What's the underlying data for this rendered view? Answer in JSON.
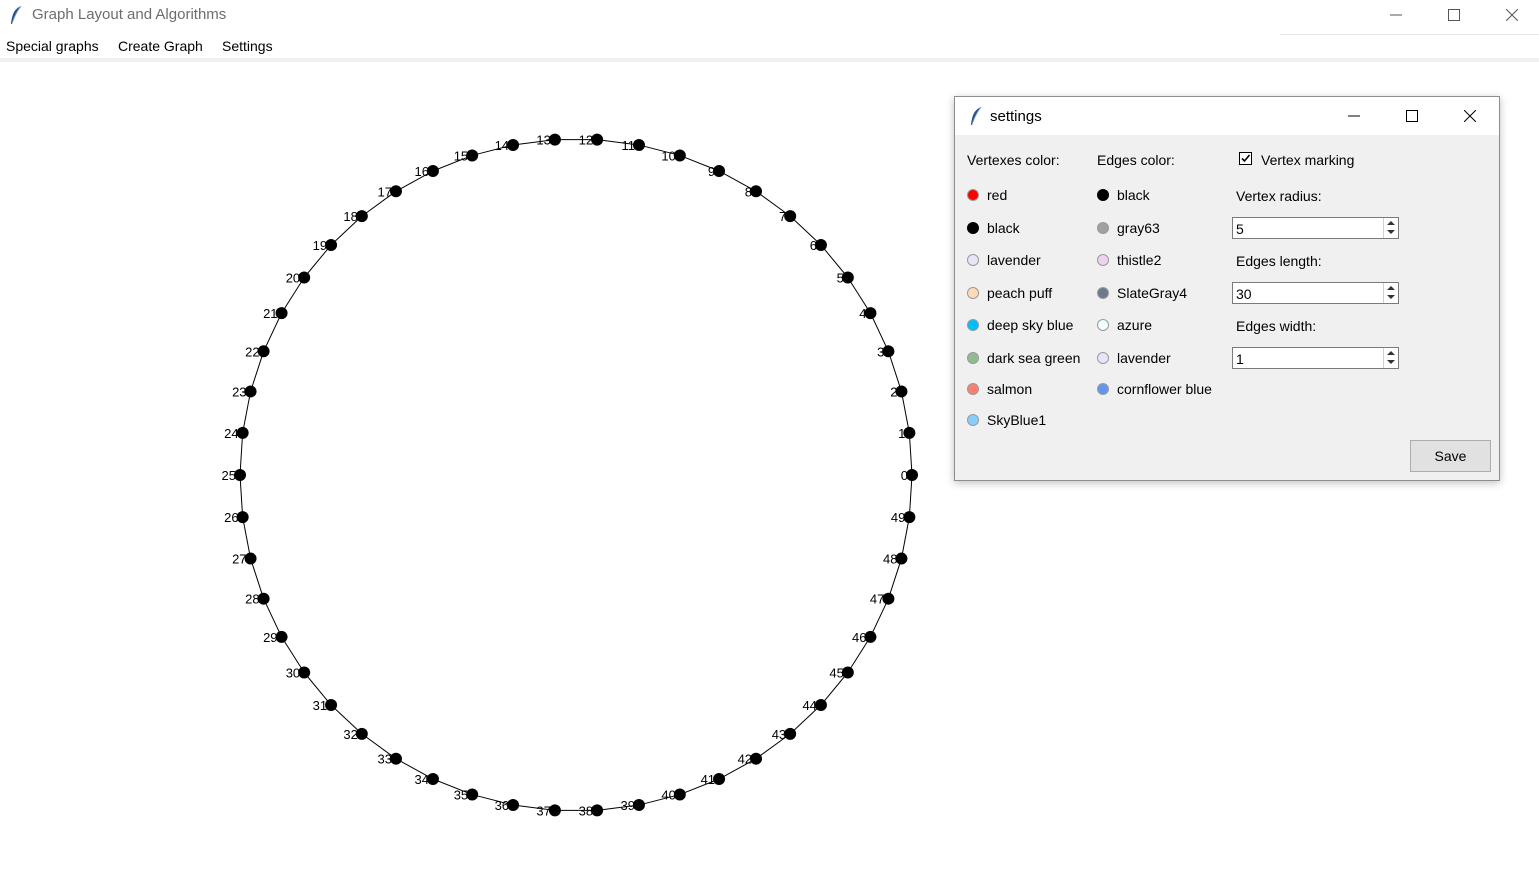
{
  "window": {
    "title": "Graph Layout and Algorithms"
  },
  "menu": [
    "Special graphs",
    "Create Graph",
    "Settings"
  ],
  "graph": {
    "vertex_count": 50,
    "vertex_labels": [
      "0",
      "1",
      "2",
      "3",
      "4",
      "5",
      "6",
      "7",
      "8",
      "9",
      "10",
      "11",
      "12",
      "13",
      "14",
      "15",
      "16",
      "17",
      "18",
      "19",
      "20",
      "21",
      "22",
      "23",
      "24",
      "25",
      "26",
      "27",
      "28",
      "29",
      "30",
      "31",
      "32",
      "33",
      "34",
      "35",
      "36",
      "37",
      "38",
      "39",
      "40",
      "41",
      "42",
      "43",
      "44",
      "45",
      "46",
      "47",
      "48",
      "49"
    ],
    "vertex_color": "#000000",
    "edge_color": "#000000"
  },
  "settings": {
    "title": "settings",
    "vertex_color_label": "Vertexes color:",
    "edge_color_label": "Edges color:",
    "vertex_marking_label": "Vertex marking",
    "vertex_marking_checked": true,
    "vertex_colors": [
      {
        "label": "red",
        "color": "#ff0000"
      },
      {
        "label": "black",
        "color": "#000000"
      },
      {
        "label": "lavender",
        "color": "#e6e6fa"
      },
      {
        "label": "peach puff",
        "color": "#ffdab9"
      },
      {
        "label": "deep sky blue",
        "color": "#00bfff"
      },
      {
        "label": "dark sea green",
        "color": "#8fbc8f"
      },
      {
        "label": "salmon",
        "color": "#fa8072"
      },
      {
        "label": "SkyBlue1",
        "color": "#87ceff"
      }
    ],
    "edge_colors": [
      {
        "label": "black",
        "color": "#000000"
      },
      {
        "label": "gray63",
        "color": "#a1a1a1"
      },
      {
        "label": "thistle2",
        "color": "#eed2ee"
      },
      {
        "label": "SlateGray4",
        "color": "#6c7b8b"
      },
      {
        "label": "azure",
        "color": "#f0ffff"
      },
      {
        "label": "lavender",
        "color": "#e6e6fa"
      },
      {
        "label": "cornflower blue",
        "color": "#6495ed"
      }
    ],
    "vertex_radius_label": "Vertex radius:",
    "vertex_radius_value": "5",
    "edges_length_label": "Edges length:",
    "edges_length_value": "30",
    "edges_width_label": "Edges width:",
    "edges_width_value": "1",
    "save_label": "Save"
  }
}
